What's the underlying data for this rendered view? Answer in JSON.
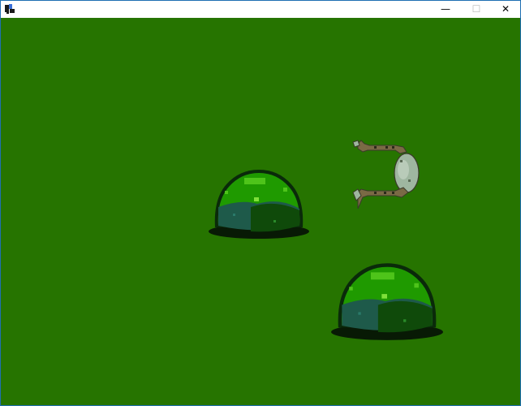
{
  "window": {
    "title": "",
    "controls": {
      "minimize_label": "—",
      "maximize_label": "☐",
      "close_label": "✕"
    },
    "border_color": "#1f6fb3"
  },
  "game": {
    "background_color": "#267400",
    "bushes": [
      {
        "name": "bush",
        "colors": {
          "outline": "#0a2a0a",
          "top": "#1f9a00",
          "highlight": "#5fd11e",
          "shade": "#1e5a4a",
          "dark": "#0f4a0a"
        }
      },
      {
        "name": "bush",
        "colors": {
          "outline": "#0a2a0a",
          "top": "#1f9a00",
          "highlight": "#5fd11e",
          "shade": "#1e5a4a",
          "dark": "#0f4a0a"
        }
      }
    ],
    "player": {
      "name": "frog-creature",
      "colors": {
        "body": "#9fb6a0",
        "limb": "#7a6a45",
        "outline": "#3a3a2a"
      }
    }
  }
}
